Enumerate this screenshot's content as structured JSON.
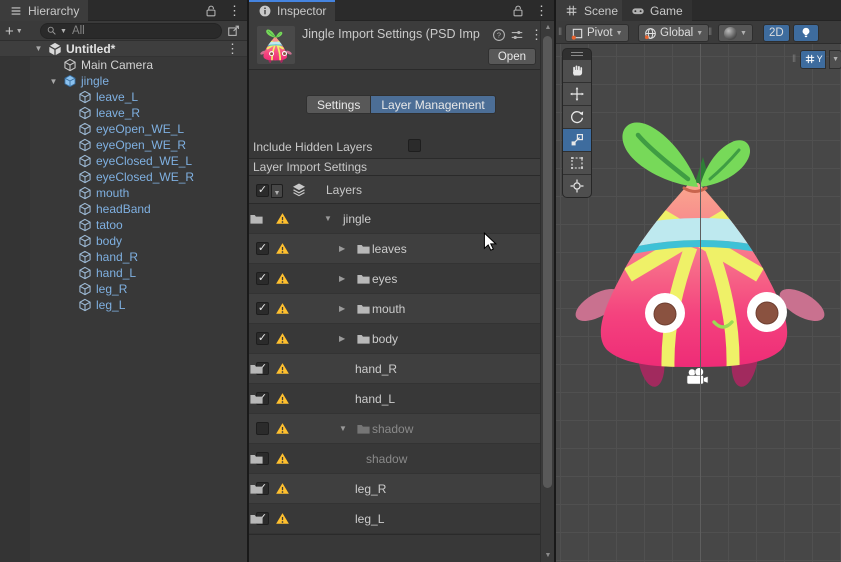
{
  "colors": {
    "focus_blue": "#4584e0",
    "tab_blue": "#4c6e96",
    "accent_blue": "#3e6c9e",
    "prefab_blue": "#7fb0e1",
    "warning_yellow": "#ffc02e",
    "scene_bg": "#474747",
    "grid_line": "#505050"
  },
  "hierarchy": {
    "tab_label": "Hierarchy",
    "plus_label": "+",
    "search_placeholder": "All",
    "items": [
      {
        "label": "Untitled*",
        "depth": 0,
        "icon": "unity",
        "expanded": true,
        "style": "scene",
        "kebab": true
      },
      {
        "label": "Main Camera",
        "depth": 1,
        "icon": "cube",
        "iconColor": "ic-white",
        "style": "normal"
      },
      {
        "label": "jingle",
        "depth": 1,
        "icon": "prefab",
        "expanded": true,
        "style": "prefab"
      },
      {
        "label": "leave_L",
        "depth": 2,
        "icon": "cube",
        "iconColor": "ic-blue",
        "style": "prefab"
      },
      {
        "label": "leave_R",
        "depth": 2,
        "icon": "cube",
        "iconColor": "ic-blue",
        "style": "prefab"
      },
      {
        "label": "eyeOpen_WE_L",
        "depth": 2,
        "icon": "cube",
        "iconColor": "ic-blue",
        "style": "prefab"
      },
      {
        "label": "eyeOpen_WE_R",
        "depth": 2,
        "icon": "cube",
        "iconColor": "ic-blue",
        "style": "prefab"
      },
      {
        "label": "eyeClosed_WE_L",
        "depth": 2,
        "icon": "cube",
        "iconColor": "ic-blue",
        "style": "prefab"
      },
      {
        "label": "eyeClosed_WE_R",
        "depth": 2,
        "icon": "cube",
        "iconColor": "ic-blue",
        "style": "prefab"
      },
      {
        "label": "mouth",
        "depth": 2,
        "icon": "cube",
        "iconColor": "ic-blue",
        "style": "prefab"
      },
      {
        "label": "headBand",
        "depth": 2,
        "icon": "cube",
        "iconColor": "ic-blue",
        "style": "prefab"
      },
      {
        "label": "tatoo",
        "depth": 2,
        "icon": "cube",
        "iconColor": "ic-blue",
        "style": "prefab"
      },
      {
        "label": "body",
        "depth": 2,
        "icon": "cube",
        "iconColor": "ic-blue",
        "style": "prefab"
      },
      {
        "label": "hand_R",
        "depth": 2,
        "icon": "cube",
        "iconColor": "ic-blue",
        "style": "prefab"
      },
      {
        "label": "hand_L",
        "depth": 2,
        "icon": "cube",
        "iconColor": "ic-blue",
        "style": "prefab"
      },
      {
        "label": "leg_R",
        "depth": 2,
        "icon": "cube",
        "iconColor": "ic-blue",
        "style": "prefab"
      },
      {
        "label": "leg_L",
        "depth": 2,
        "icon": "cube",
        "iconColor": "ic-blue",
        "style": "prefab"
      }
    ]
  },
  "inspector": {
    "tab_label": "Inspector",
    "title": "Jingle Import Settings (PSD Imp",
    "open_label": "Open",
    "tabs": [
      {
        "label": "Settings",
        "active": false
      },
      {
        "label": "Layer Management",
        "active": true
      }
    ],
    "include_hidden_label": "Include Hidden Layers",
    "include_hidden_checked": false,
    "section_label": "Layer Import Settings",
    "layers_label": "Layers",
    "rows": [
      {
        "name": "jingle",
        "kind": "root",
        "arrow": "down"
      },
      {
        "name": "leaves",
        "kind": "group",
        "arrow": "right",
        "checked": true,
        "folder": true
      },
      {
        "name": "eyes",
        "kind": "group",
        "arrow": "right",
        "checked": true,
        "folder": true
      },
      {
        "name": "mouth",
        "kind": "group",
        "arrow": "right",
        "checked": true,
        "folder": true
      },
      {
        "name": "body",
        "kind": "group",
        "arrow": "right",
        "checked": true,
        "folder": true
      },
      {
        "name": "hand_R",
        "kind": "item",
        "checked": true
      },
      {
        "name": "hand_L",
        "kind": "item",
        "checked": true
      },
      {
        "name": "shadow",
        "kind": "group",
        "arrow": "down",
        "checked": false,
        "warning": true,
        "folder": true,
        "dim": true
      },
      {
        "name": "shadow",
        "kind": "child",
        "checked": false,
        "warning": true,
        "dim": true
      },
      {
        "name": "leg_R",
        "kind": "item",
        "checked": true
      },
      {
        "name": "leg_L",
        "kind": "item",
        "checked": true
      }
    ]
  },
  "scene": {
    "tabs": [
      {
        "label": "Scene"
      },
      {
        "label": "Game"
      }
    ],
    "toolbar": {
      "pivot_label": "Pivot",
      "global_label": "Global",
      "mode_2d_label": "2D"
    },
    "grid_axis_label": "Y",
    "tools": [
      {
        "name": "hand"
      },
      {
        "name": "move"
      },
      {
        "name": "rotate"
      },
      {
        "name": "scale",
        "selected": true
      },
      {
        "name": "rect"
      },
      {
        "name": "transform"
      }
    ]
  }
}
